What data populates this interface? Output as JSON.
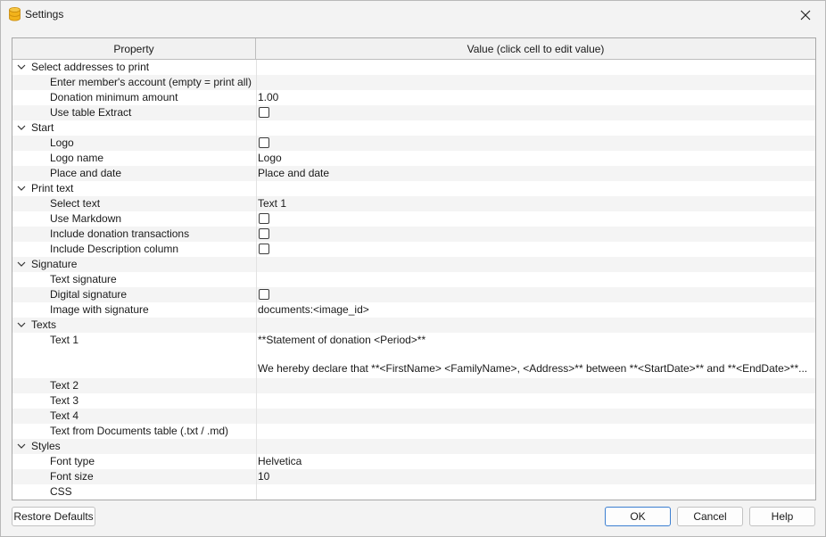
{
  "window": {
    "title": "Settings",
    "app_icon": "database-icon",
    "close_icon": "close-icon"
  },
  "grid": {
    "headers": {
      "property": "Property",
      "value": "Value (click cell to edit value)"
    },
    "rows": [
      {
        "label": "Select addresses to print",
        "group": true,
        "expanded": true
      },
      {
        "label": "Enter member's account (empty = print all)"
      },
      {
        "label": "Donation minimum amount",
        "value": "1.00"
      },
      {
        "label": "Use table Extract",
        "checkbox": true,
        "checked": false
      },
      {
        "label": "Start",
        "group": true,
        "expanded": true
      },
      {
        "label": "Logo",
        "checkbox": true,
        "checked": false
      },
      {
        "label": "Logo name",
        "value": "Logo"
      },
      {
        "label": "Place and date",
        "value": "Place and date"
      },
      {
        "label": "Print text",
        "group": true,
        "expanded": true
      },
      {
        "label": "Select text",
        "value": "Text 1"
      },
      {
        "label": "Use Markdown",
        "checkbox": true,
        "checked": false
      },
      {
        "label": "Include donation transactions",
        "checkbox": true,
        "checked": false
      },
      {
        "label": "Include Description column",
        "checkbox": true,
        "checked": false
      },
      {
        "label": "Signature",
        "group": true,
        "expanded": true
      },
      {
        "label": "Text signature"
      },
      {
        "label": "Digital signature",
        "checkbox": true,
        "checked": false
      },
      {
        "label": "Image with signature",
        "value": "documents:<image_id>"
      },
      {
        "label": "Texts",
        "group": true,
        "expanded": true
      },
      {
        "label": "Text 1",
        "multiline": [
          "**Statement of donation <Period>**",
          "",
          "We hereby declare that **<FirstName> <FamilyName>, <Address>** between **<StartDate>** and **<EndDate>**..."
        ]
      },
      {
        "label": "Text 2"
      },
      {
        "label": "Text 3"
      },
      {
        "label": "Text 4"
      },
      {
        "label": "Text from Documents table (.txt / .md)"
      },
      {
        "label": "Styles",
        "group": true,
        "expanded": true
      },
      {
        "label": "Font type",
        "value": "Helvetica"
      },
      {
        "label": "Font size",
        "value": "10"
      },
      {
        "label": "CSS"
      }
    ]
  },
  "buttons": {
    "restore_defaults": "Restore Defaults",
    "ok": "OK",
    "cancel": "Cancel",
    "help": "Help"
  },
  "colors": {
    "accent": "#3c7fd1",
    "app_icon": "#f2b31b"
  }
}
